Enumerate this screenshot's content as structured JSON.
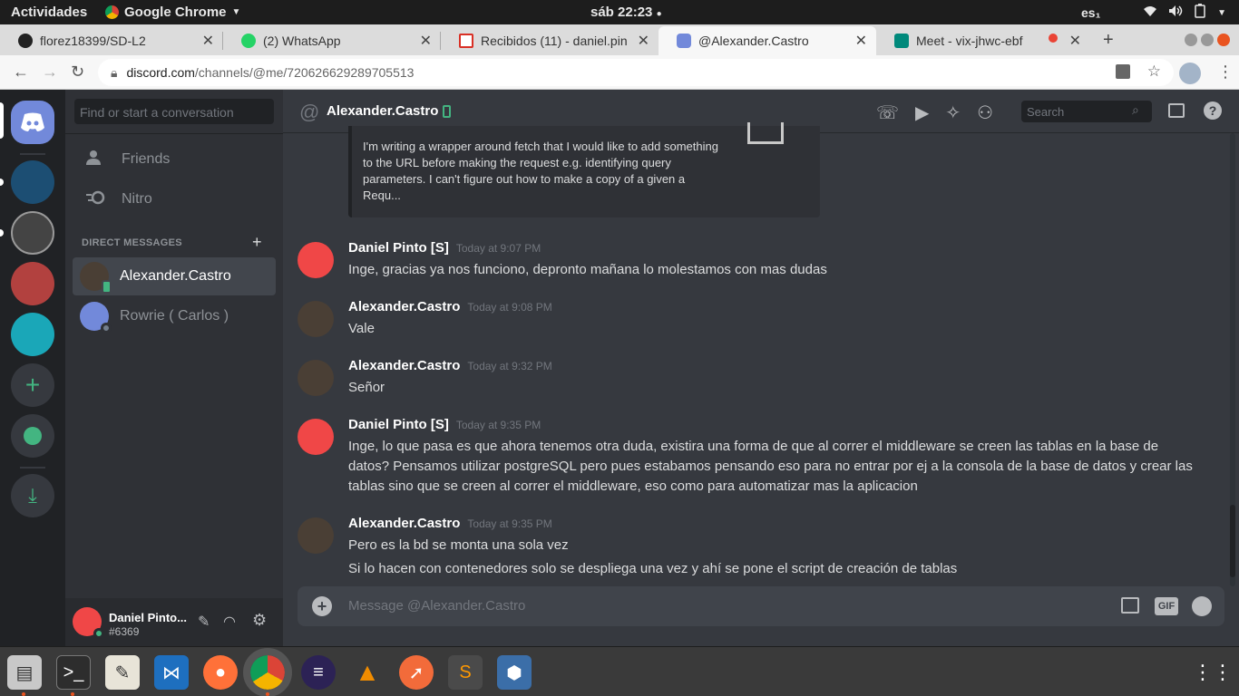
{
  "os": {
    "activities": "Actividades",
    "app_name": "Google Chrome",
    "clock": "sáb 22:23",
    "lang": "es₁"
  },
  "tabs": [
    {
      "label": "florez18399/SD-L2",
      "icon": "github-icon"
    },
    {
      "label": "(2) WhatsApp",
      "icon": "whatsapp-icon"
    },
    {
      "label": "Recibidos (11) - daniel.pin",
      "icon": "gmail-icon"
    },
    {
      "label": "@Alexander.Castro",
      "icon": "discord-icon"
    },
    {
      "label": "Meet - vix-jhwc-ebf",
      "icon": "meet-icon"
    }
  ],
  "url": {
    "domain": "discord.com",
    "path": "/channels/@me/720626629289705513"
  },
  "sidebar": {
    "search_placeholder": "Find or start a conversation",
    "friends": "Friends",
    "nitro": "Nitro",
    "dm_header": "DIRECT MESSAGES",
    "dms": [
      {
        "name": "Alexander.Castro"
      },
      {
        "name": "Rowrie ( Carlos )"
      }
    ],
    "user": {
      "name": "Daniel Pinto...",
      "tag": "#6369"
    }
  },
  "chat": {
    "title": "Alexander.Castro",
    "search_placeholder": "Search",
    "embed_text": "I'm writing a wrapper around fetch that I would like to add something to the URL before making the request e.g. identifying query parameters. I can't figure out how to make a copy of a given a Requ...",
    "messages": [
      {
        "author": "Daniel Pinto [S]",
        "time": "Today at 9:07 PM",
        "text": "Inge, gracias ya nos funciono, depronto mañana lo molestamos con mas dudas"
      },
      {
        "author": "Alexander.Castro",
        "time": "Today at 9:08 PM",
        "text": "Vale"
      },
      {
        "author": "Alexander.Castro",
        "time": "Today at 9:32 PM",
        "text": "Señor"
      },
      {
        "author": "Daniel Pinto [S]",
        "time": "Today at 9:35 PM",
        "text": "Inge, lo que pasa es que ahora tenemos otra duda, existira una forma de que al correr el middleware se creen las tablas en la base de datos? Pensamos utilizar postgreSQL pero pues estabamos pensando eso para no entrar por ej a la consola de la base de datos y crear las tablas sino que se creen al correr el middleware, eso como para automatizar mas la aplicacion"
      },
      {
        "author": "Alexander.Castro",
        "time": "Today at 9:35 PM",
        "text": "Pero es la bd se monta una sola vez",
        "text2": "Si lo hacen con contenedores solo se despliega una vez y ahí se pone el script de creación de tablas"
      }
    ],
    "composer_placeholder": "Message @Alexander.Castro",
    "gif_label": "GIF"
  },
  "colors": {
    "discord_blurple": "#7289da",
    "discord_red": "#f04747",
    "online_green": "#43b581",
    "ubuntu_orange": "#e95420"
  }
}
